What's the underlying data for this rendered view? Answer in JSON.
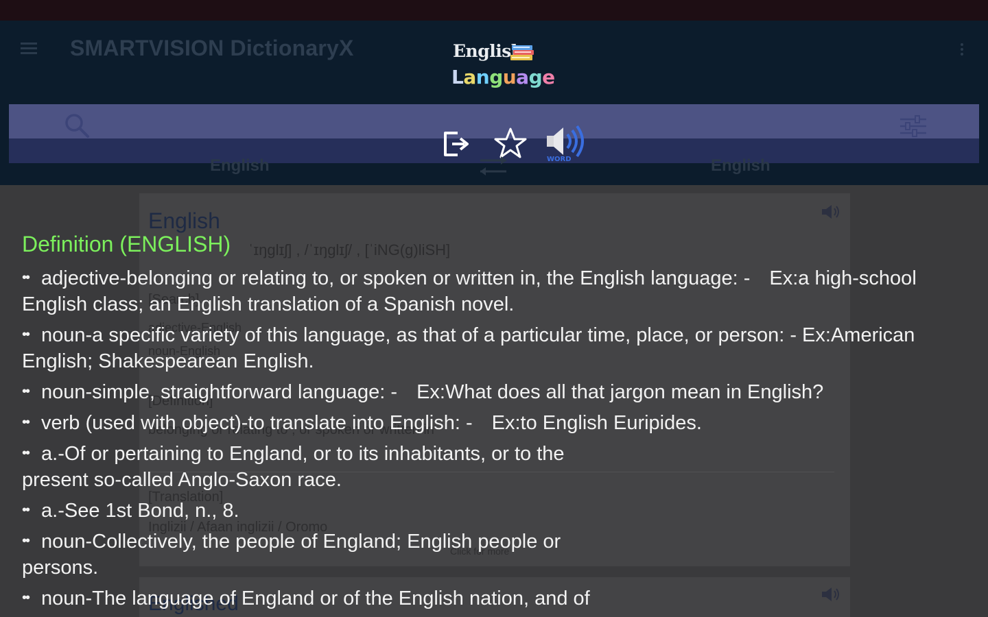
{
  "app": {
    "title": "SMARTVISION DictionaryX",
    "logo_line1": "English",
    "logo_line2": "Language"
  },
  "icons": {
    "menu": "hamburger-menu-icon",
    "overflow": "more-vert-icon",
    "search": "search-icon",
    "filter": "tune-icon",
    "exit": "exit-icon",
    "favorite": "star-icon",
    "speak": "speaker-word-icon",
    "swap": "swap-arrows-icon"
  },
  "speak_badge": "WORD",
  "languages": {
    "source": "English",
    "target": "English"
  },
  "background_card": {
    "headword": "English",
    "phonetic": "ˈɪŋglɪʃ] , /ˈɪŋglɪʃ/ , [ˈiNG(g)liSH]",
    "fragment_1": "[Search]",
    "fragment_2": "adjective-English",
    "fragment_3": "noun-English",
    "fragment_4": "[Definition]",
    "fragment_5": "belonging or relating to , or spoken or written in",
    "fragment_6": "[Translation]",
    "fragment_7": "Inglizii / Afaan inglizii / Oromo",
    "fragment_8": "Click for more",
    "next_headword": "Englished"
  },
  "definition": {
    "title": "Definition (ENGLISH)",
    "items": [
      {
        "text": "adjective-belonging or relating to, or spoken or written in, the English language: -",
        "example": "Ex:a high-school English class; an English translation of a Spanish novel."
      },
      {
        "text": "noun-a specific variety of this language, as that of a particular time, place, or person: -",
        "example": "Ex:American English; Shakespearean English."
      },
      {
        "text": "noun-simple, straightforward language: -",
        "example": "Ex:What does all that jargon mean in English?"
      },
      {
        "text": "verb (used with object)-to translate into English: -",
        "example": "Ex:to English Euripides."
      },
      {
        "text": "a.-Of or pertaining to England, or to its inhabitants, or to the present so-called Anglo-Saxon race.",
        "example": ""
      },
      {
        "text": "a.-See 1st Bond, n., 8.",
        "example": ""
      },
      {
        "text": "noun-Collectively, the people of England; English people or persons.",
        "example": ""
      },
      {
        "text": "noun-The language of England or of the English nation, and of",
        "example": ""
      }
    ]
  },
  "colors": {
    "appbar": "#0c1c2c",
    "search_band": "#4d5384",
    "definition_title": "#7cf05c",
    "definition_text": "#f2f2f2"
  }
}
